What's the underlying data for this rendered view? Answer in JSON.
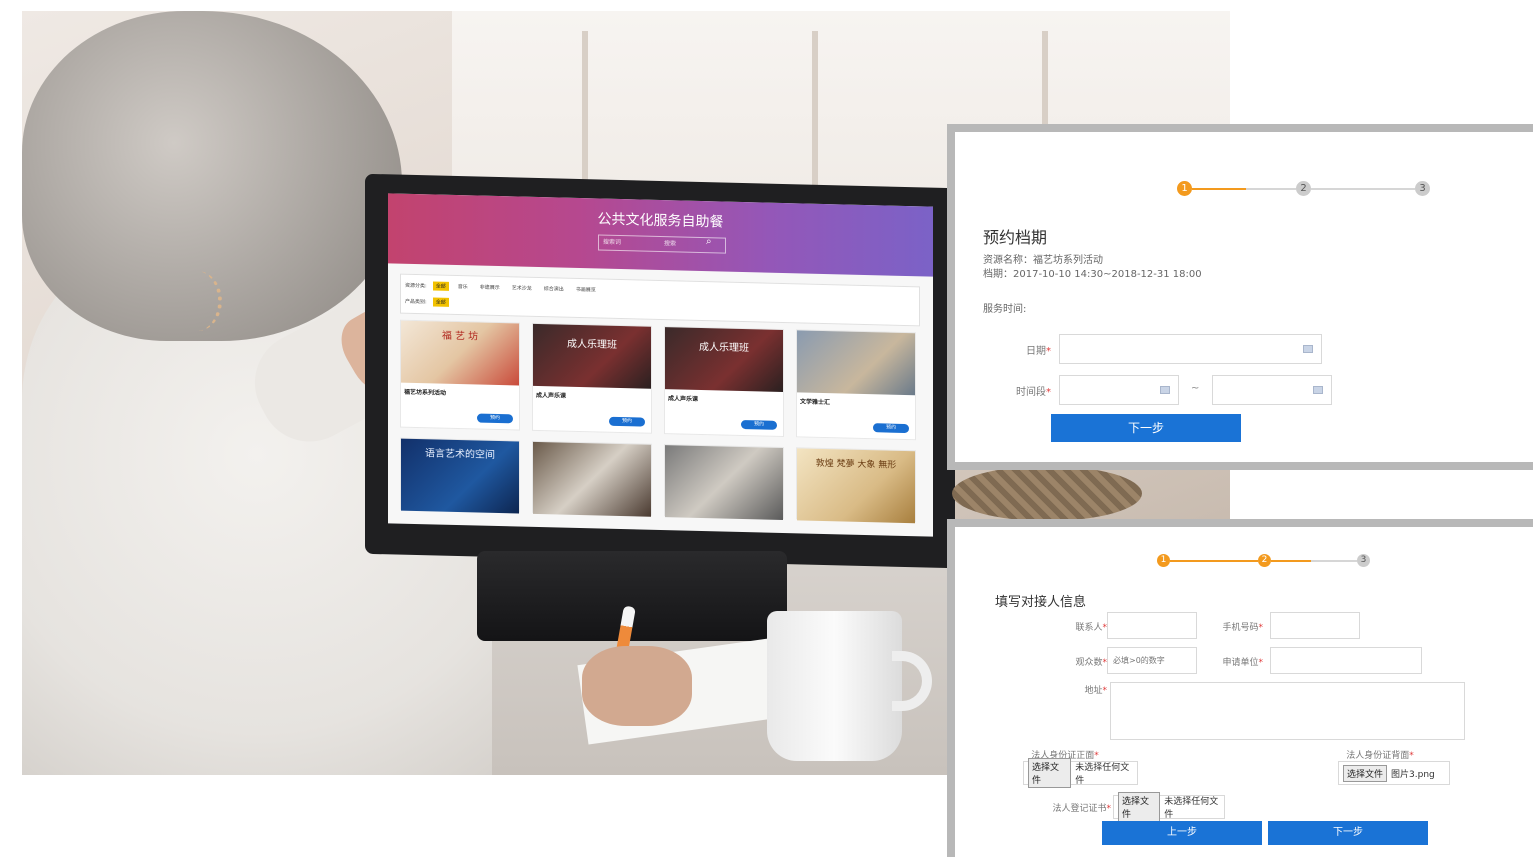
{
  "screen": {
    "title": "公共文化服务自助餐",
    "search_placeholder": "搜索词",
    "search_button": "搜索",
    "filter_row1_label": "资源分类:",
    "filter_row1": [
      "全部",
      "音乐",
      "非遗展示",
      "艺术沙龙",
      "综合演出",
      "书画展览"
    ],
    "filter_row2_label": "产品类别:",
    "filter_row2": [
      "全部"
    ],
    "book_label": "预约",
    "cards": [
      {
        "name": "福艺坊系列活动",
        "overlay": "福 艺 坊"
      },
      {
        "name": "成人声乐课",
        "overlay": "成人乐理班"
      },
      {
        "name": "成人声乐课",
        "overlay": "成人乐理班"
      },
      {
        "name": "文学雅士汇",
        "overlay": ""
      },
      {
        "name": "",
        "overlay": "语言艺术的空间"
      },
      {
        "name": "",
        "overlay": ""
      },
      {
        "name": "",
        "overlay": ""
      },
      {
        "name": "",
        "overlay": "敦煌 梵夢 大象 無形"
      }
    ]
  },
  "panel1": {
    "steps": [
      "1",
      "2",
      "3"
    ],
    "title": "预约档期",
    "resource_name": "资源名称：福艺坊系列活动",
    "schedule": "档期：2017-10-10 14:30~2018-12-31 18:00",
    "service_time_label": "服务时间:",
    "date_label": "日期",
    "time_label": "时间段",
    "required_mark": "*",
    "tilde": "~",
    "next_button": "下一步"
  },
  "panel2": {
    "steps": [
      "1",
      "2",
      "3"
    ],
    "title": "填写对接人信息",
    "contact_label": "联系人",
    "phone_label": "手机号码",
    "audience_label": "观众数",
    "audience_placeholder": "必填>0的数字",
    "unit_label": "申请单位",
    "address_label": "地址",
    "id_front_label": "法人身份证正面",
    "id_back_label": "法人身份证背面",
    "registration_label": "法人登记证书",
    "choose_file": "选择文件",
    "no_file": "未选择任何文件",
    "back_file": "图片3.png",
    "required_mark": "*",
    "prev_button": "上一步",
    "next_button": "下一步"
  },
  "colors": {
    "accent_blue": "#1a73d6",
    "step_orange": "#f39a1e",
    "required_red": "#e03a3a"
  }
}
